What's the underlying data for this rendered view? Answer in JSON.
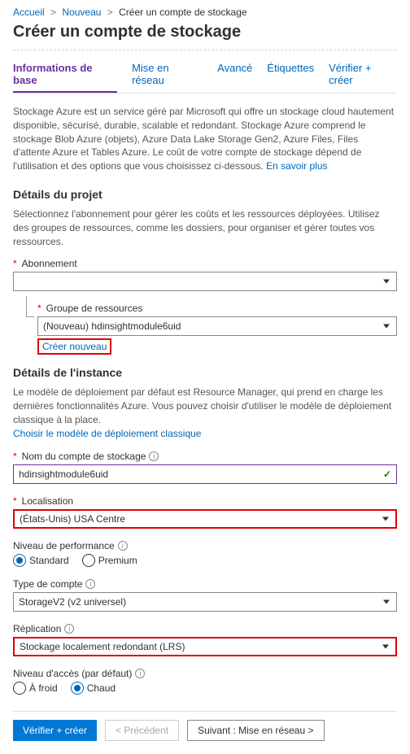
{
  "breadcrumb": {
    "home": "Accueil",
    "new": "Nouveau",
    "current": "Créer un compte de stockage"
  },
  "title": "Créer un compte de stockage",
  "tabs": {
    "basics": "Informations de base",
    "networking": "Mise en réseau",
    "advanced": "Avancé",
    "tags": "Étiquettes",
    "review": "Vérifier + créer"
  },
  "intro": {
    "text": "Stockage Azure est un service géré par Microsoft qui offre un stockage cloud hautement disponible, sécurisé, durable, scalable et redondant. Stockage Azure comprend le stockage Blob Azure (objets), Azure Data Lake Storage Gen2, Azure Files, Files d'attente Azure et Tables Azure. Le coût de votre compte de stockage dépend de l'utilisation et des options que vous choisissez ci-dessous. ",
    "link": "En savoir plus"
  },
  "project": {
    "heading": "Détails du projet",
    "desc": "Sélectionnez l'abonnement pour gérer les coûts et les ressources déployées. Utilisez des groupes de ressources, comme les dossiers, pour organiser et gérer toutes vos ressources.",
    "subscription_label": "Abonnement",
    "subscription_value": "",
    "rg_label": "Groupe de ressources",
    "rg_value": "(Nouveau) hdinsightmodule6uid",
    "create_new": "Créer nouveau"
  },
  "instance": {
    "heading": "Détails de l'instance",
    "desc_pre": "Le modèle de déploiement par défaut est Resource Manager, qui prend en charge les dernières fonctionnalités Azure. Vous pouvez choisir d'utiliser le modèle de déploiement classique à la place.",
    "desc_link": "Choisir le modèle de déploiement classique",
    "name_label": "Nom du compte de stockage",
    "name_value": "hdinsightmodule6uid",
    "location_label": "Localisation",
    "location_value": "(États-Unis) USA Centre",
    "perf_label": "Niveau de performance",
    "perf_standard": "Standard",
    "perf_premium": "Premium",
    "kind_label": "Type de compte",
    "kind_value": "StorageV2 (v2 universel)",
    "replication_label": "Réplication",
    "replication_value": "Stockage localement redondant (LRS)",
    "tier_label": "Niveau d'accès (par défaut)",
    "tier_cold": "À froid",
    "tier_hot": "Chaud"
  },
  "footer": {
    "review": "Vérifier + créer",
    "prev": "<  Précédent",
    "next": "Suivant : Mise en réseau >"
  }
}
